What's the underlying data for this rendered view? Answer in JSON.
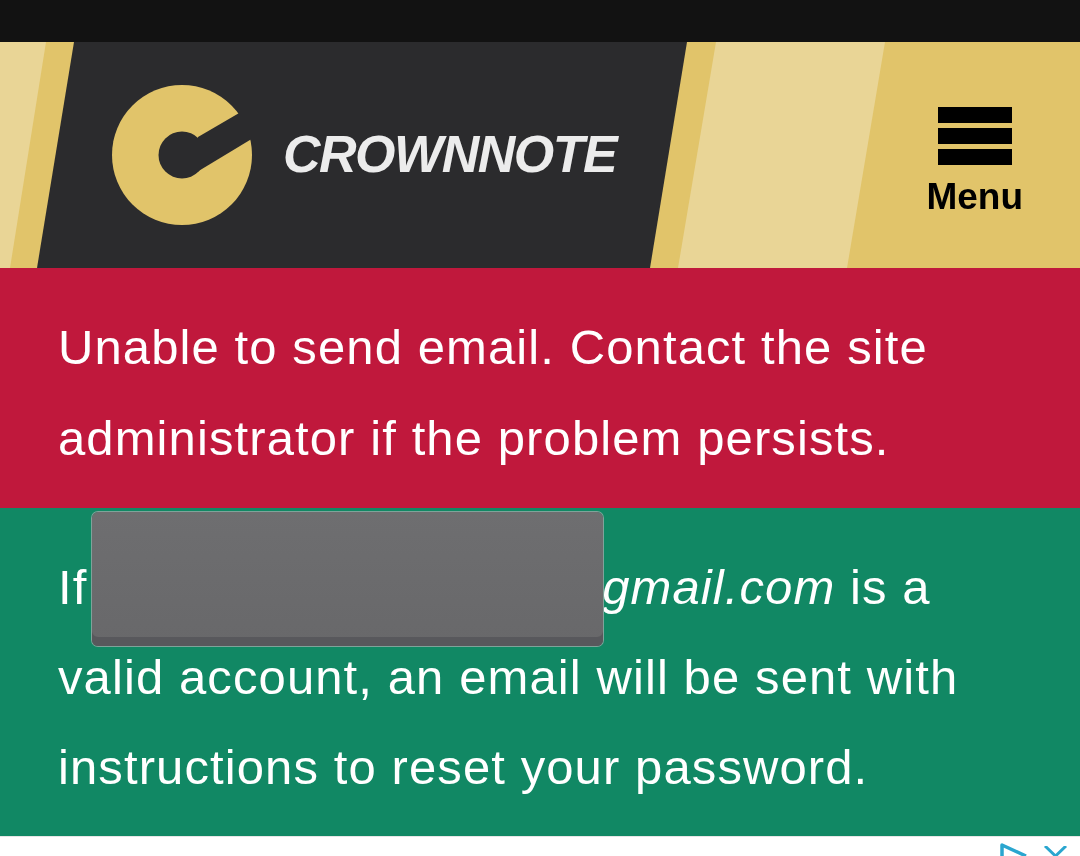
{
  "header": {
    "brand": "CROWNNOTE",
    "menu_label": "Menu"
  },
  "messages": [
    {
      "kind": "error",
      "lines": [
        "Unable to send email. Contact the site",
        "administrator if the problem persists."
      ]
    },
    {
      "kind": "success",
      "lead": "If",
      "redacted": true,
      "lines": [
        "*gmail.com* is a",
        "valid account, an email will be sent with",
        "instructions to reset your password."
      ]
    }
  ]
}
